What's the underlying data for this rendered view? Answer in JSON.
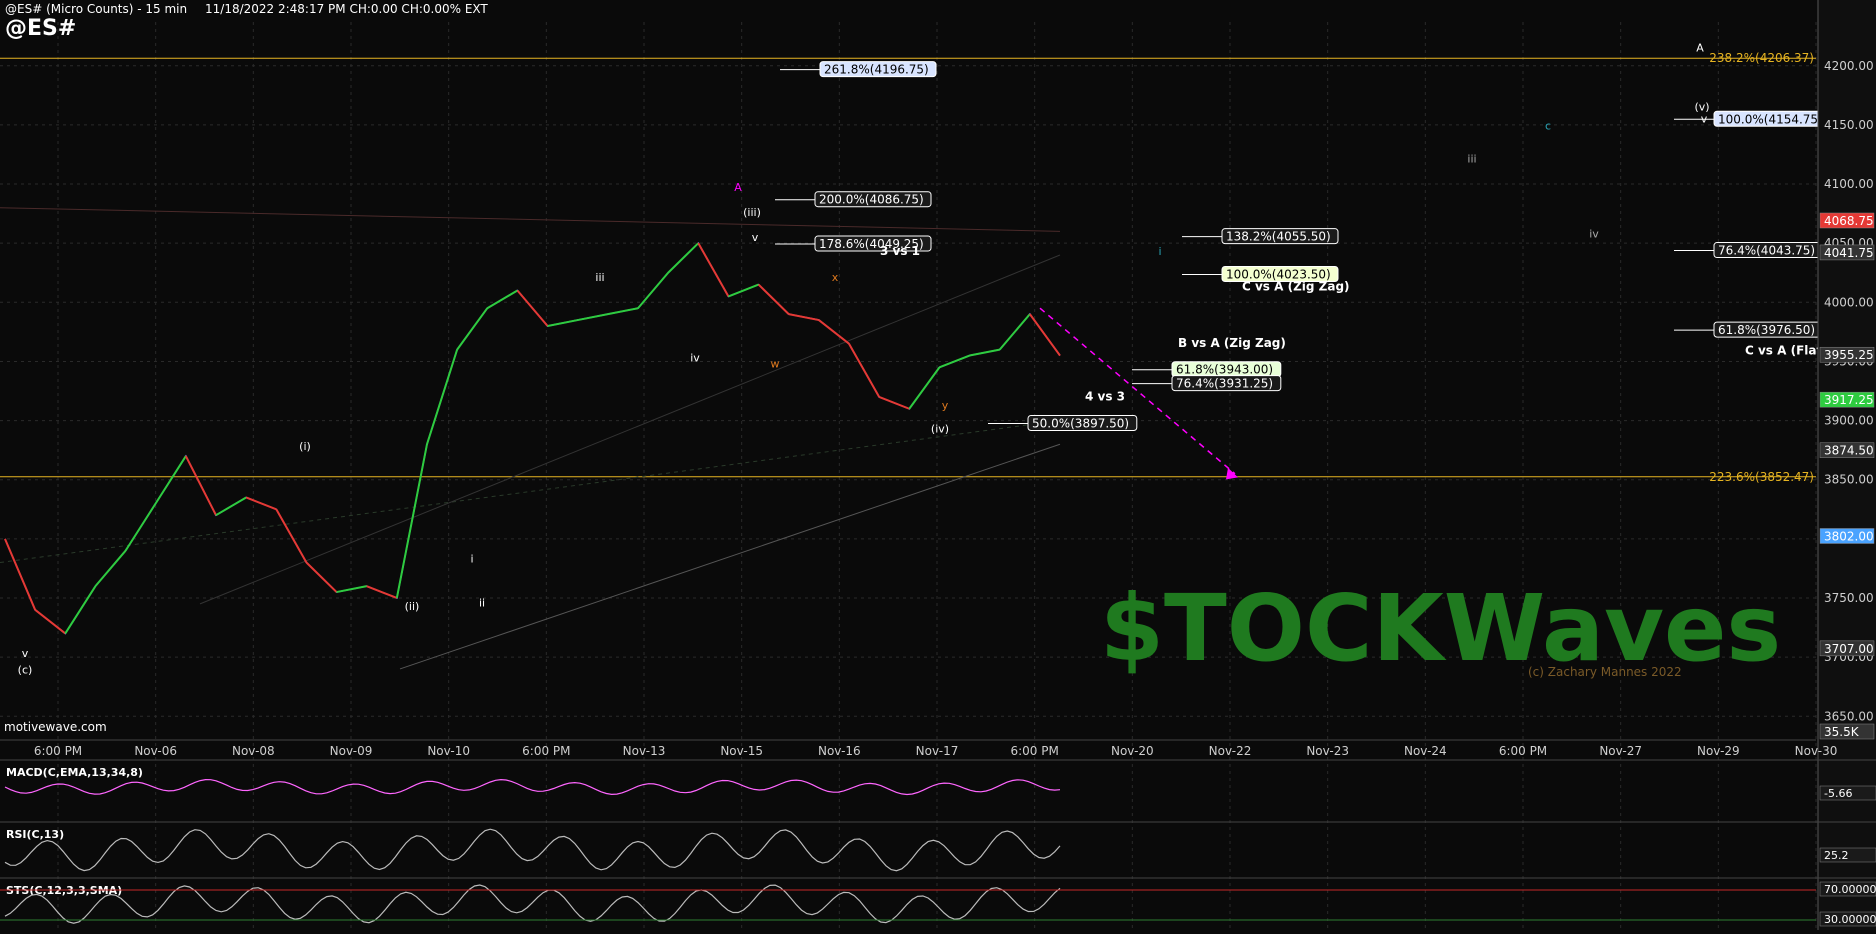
{
  "header": {
    "title": "@ES# (Micro Counts) - 15 min",
    "symbol": "@ES#",
    "info": "11/18/2022 2:48:17 PM  CH:0.00  CH:0.00%  EXT",
    "watermark_site": "motivewave.com"
  },
  "colors": {
    "background": "#0a0a0a",
    "fib_line": "#e6b422",
    "magenta": "#ff00ff",
    "teal": "#2aa6b8",
    "orange": "#e07a1f",
    "price_up": "#2ecc40",
    "price_down": "#e53935",
    "ma": "#8c7bff",
    "ma2": "#4aa3ff"
  },
  "chart_data": {
    "type": "candlestick",
    "x_axis_labels": [
      "6:00 PM",
      "Nov-06",
      "Nov-08",
      "Nov-09",
      "Nov-10",
      "6:00 PM",
      "Nov-13",
      "Nov-15",
      "Nov-16",
      "Nov-17",
      "6:00 PM",
      "Nov-20",
      "Nov-22",
      "Nov-23",
      "Nov-24",
      "6:00 PM",
      "Nov-27",
      "Nov-29",
      "Nov-30"
    ],
    "y_axis_ticks": [
      3650,
      3700,
      3750,
      3800,
      3850,
      3900,
      3950,
      4000,
      4050,
      4100,
      4150,
      4200
    ],
    "ylim": [
      3635,
      4237
    ],
    "price_path": [
      3800,
      3740,
      3720,
      3760,
      3790,
      3830,
      3870,
      3820,
      3835,
      3825,
      3780,
      3755,
      3760,
      3750,
      3880,
      3960,
      3995,
      4010,
      3980,
      3985,
      3990,
      3995,
      4025,
      4050,
      4005,
      4015,
      3990,
      3985,
      3965,
      3920,
      3910,
      3945,
      3955,
      3960,
      3990,
      3955
    ],
    "axis_price_labels": [
      {
        "label": "4068.75",
        "price": 4068.75,
        "color": "#e53935"
      },
      {
        "label": "4041.75",
        "price": 4041.75,
        "color": "#333333"
      },
      {
        "label": "3955.25",
        "price": 3955.25,
        "color": "#333333"
      },
      {
        "label": "3917.25",
        "price": 3917.25,
        "color": "#2ecc40"
      },
      {
        "label": "3874.50",
        "price": 3874.5,
        "color": "#333333"
      },
      {
        "label": "3802.00",
        "price": 3802.0,
        "color": "#4aa3ff"
      },
      {
        "label": "3707.00",
        "price": 3707.0,
        "color": "#333333"
      },
      {
        "label": "35.5K",
        "price": 3640,
        "color": "#333333"
      }
    ],
    "fib_lines": [
      {
        "label": "238.2%(4206.37)",
        "price": 4206.37
      },
      {
        "label": "223.6%(3852.47)",
        "price": 3852.47
      }
    ],
    "fib_boxes": [
      {
        "label": "261.8%(4196.75)",
        "price": 4196.75,
        "bg": "#d8e4ff"
      },
      {
        "label": "200.0%(4086.75)",
        "price": 4086.75,
        "bg": "#1a1a1a"
      },
      {
        "label": "178.6%(4049.25)",
        "price": 4049.25,
        "bg": "#1a1a1a"
      },
      {
        "label": "138.2%(4055.50)",
        "price": 4055.5,
        "bg": "#1a1a1a"
      },
      {
        "label": "100.0%(4023.50)",
        "price": 4023.5,
        "bg": "#f4ffd0"
      },
      {
        "label": "61.8%(3943.00)",
        "price": 3943.0,
        "bg": "#e8ffd8"
      },
      {
        "label": "76.4%(3931.25)",
        "price": 3931.25,
        "bg": "#1a1a1a"
      },
      {
        "label": "50.0%(3897.50)",
        "price": 3897.5,
        "bg": "#1a1a1a"
      },
      {
        "label": "100.0%(4154.75)",
        "price": 4154.75,
        "bg": "#d8e4ff"
      },
      {
        "label": "76.4%(4043.75)",
        "price": 4043.75,
        "bg": "#1a1a1a"
      },
      {
        "label": "61.8%(3976.50)",
        "price": 3976.5,
        "bg": "#1a1a1a"
      }
    ],
    "annotations": [
      {
        "text": "3 vs 1",
        "color": "#ffffff"
      },
      {
        "text": "C vs A (Zig Zag)",
        "color": "#ffffff"
      },
      {
        "text": "B vs A (Zig Zag)",
        "color": "#ffffff"
      },
      {
        "text": "4 vs 3",
        "color": "#ffffff"
      },
      {
        "text": "C vs A (Flat)",
        "color": "#ffffff"
      }
    ],
    "wave_labels": [
      {
        "text": "v"
      },
      {
        "text": "(c)"
      },
      {
        "text": "(i)"
      },
      {
        "text": "(ii)"
      },
      {
        "text": "i"
      },
      {
        "text": "ii"
      },
      {
        "text": "iii"
      },
      {
        "text": "iv"
      },
      {
        "text": "v"
      },
      {
        "text": "(iii)"
      },
      {
        "text": "A"
      },
      {
        "text": "w"
      },
      {
        "text": "x"
      },
      {
        "text": "y"
      },
      {
        "text": "(iv)"
      },
      {
        "text": "i"
      },
      {
        "text": "iii"
      },
      {
        "text": "iv"
      },
      {
        "text": "A"
      },
      {
        "text": "(v)"
      },
      {
        "text": "v"
      },
      {
        "text": "c"
      }
    ],
    "indicators": [
      {
        "name": "MACD(C,EMA,13,34,8)",
        "value_label": "-5.66"
      },
      {
        "name": "RSI(C,13)",
        "value_label": "25.2"
      },
      {
        "name": "STS(C,12,3,3,SMA)",
        "value_labels": [
          "70.00000",
          "30.00000"
        ]
      }
    ],
    "logo": {
      "text": "$TOCKWaves",
      "tagline": "(c) Zachary Mannes 2022"
    }
  }
}
